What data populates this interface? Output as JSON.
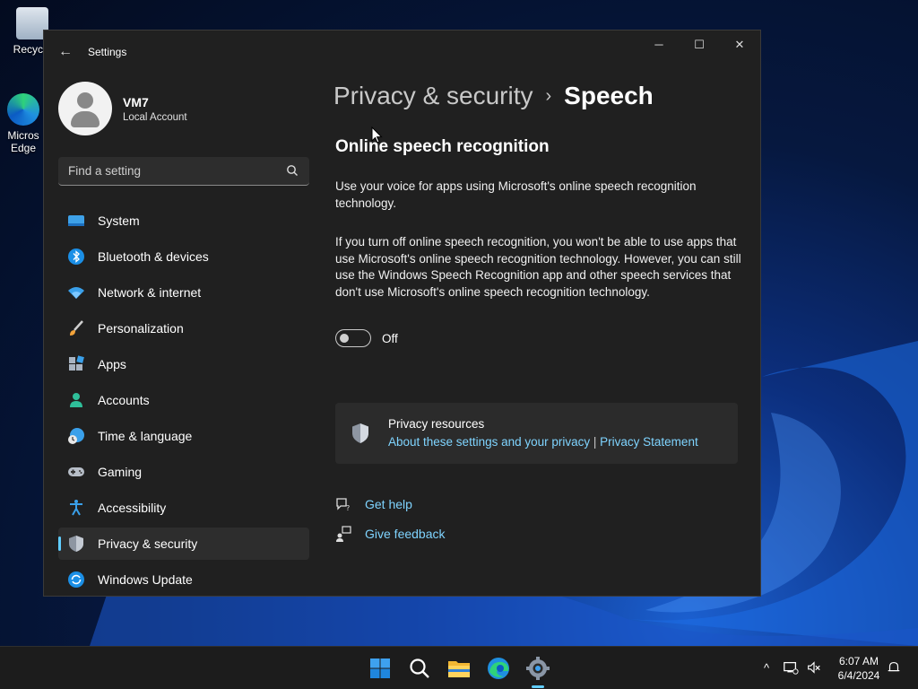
{
  "desktop": {
    "icons": [
      {
        "label": "Recycle"
      },
      {
        "label": "Micros Edge"
      }
    ]
  },
  "window": {
    "title": "Settings",
    "controls": {
      "minimize": "─",
      "maximize": "☐",
      "close": "✕"
    }
  },
  "profile": {
    "name": "VM7",
    "account_type": "Local Account"
  },
  "search": {
    "placeholder": "Find a setting"
  },
  "sidebar": {
    "items": [
      {
        "label": "System",
        "icon": "system-icon"
      },
      {
        "label": "Bluetooth & devices",
        "icon": "bluetooth-icon"
      },
      {
        "label": "Network & internet",
        "icon": "wifi-icon"
      },
      {
        "label": "Personalization",
        "icon": "brush-icon"
      },
      {
        "label": "Apps",
        "icon": "apps-icon"
      },
      {
        "label": "Accounts",
        "icon": "accounts-icon"
      },
      {
        "label": "Time & language",
        "icon": "clock-globe-icon"
      },
      {
        "label": "Gaming",
        "icon": "gamepad-icon"
      },
      {
        "label": "Accessibility",
        "icon": "accessibility-icon"
      },
      {
        "label": "Privacy & security",
        "icon": "shield-icon",
        "active": true
      },
      {
        "label": "Windows Update",
        "icon": "update-icon"
      }
    ]
  },
  "breadcrumb": {
    "parent": "Privacy & security",
    "separator": "›",
    "current": "Speech"
  },
  "main": {
    "section_title": "Online speech recognition",
    "description": "Use your voice for apps using Microsoft's online speech recognition technology.",
    "warning": "If you turn off online speech recognition, you won't be able to use apps that use Microsoft's online speech recognition technology.  However, you can still use the Windows Speech Recognition app and other speech services that don't use Microsoft's online speech recognition technology.",
    "toggle": {
      "state": "Off",
      "on": false
    }
  },
  "resources": {
    "title": "Privacy resources",
    "link1": "About these settings and your privacy",
    "divider": " | ",
    "link2": "Privacy Statement"
  },
  "help": {
    "get_help": "Get help",
    "give_feedback": "Give feedback"
  },
  "taskbar": {
    "apps": [
      "start-icon",
      "search-icon",
      "file-explorer-icon",
      "edge-icon",
      "settings-icon"
    ],
    "active_app": "settings-icon",
    "tray": {
      "chevron": "^"
    },
    "time": "6:07 AM",
    "date": "6/4/2024"
  },
  "colors": {
    "accent": "#60cdff",
    "link": "#7fd4ff",
    "window_bg": "#202020",
    "card_bg": "#2b2b2b"
  }
}
